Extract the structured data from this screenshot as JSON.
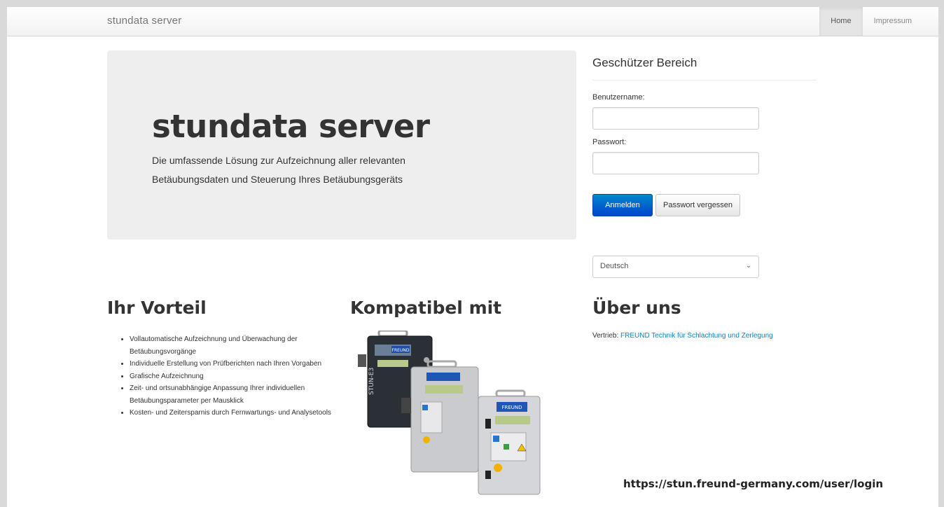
{
  "navbar": {
    "brand": "stundata server",
    "items": [
      {
        "label": "Home",
        "active": true
      },
      {
        "label": "Impressum",
        "active": false
      }
    ]
  },
  "hero": {
    "title": "stundata server",
    "tagline_line1": "Die umfassende Lösung zur Aufzeichnung aller relevanten",
    "tagline_line2": "Betäubungsdaten und Steuerung Ihres Betäubungsgeräts"
  },
  "login": {
    "title": "Geschützer Bereich",
    "username_label": "Benutzername:",
    "username_value": "",
    "password_label": "Passwort:",
    "password_value": "",
    "submit_label": "Anmelden",
    "forgot_label": "Passwort vergessen",
    "language_selected": "Deutsch"
  },
  "vorteil": {
    "title": "Ihr Vorteil",
    "items": [
      "Vollautomatische Aufzeichnung und Überwachung der Betäubungsvorgänge",
      "Individuelle Erstellung von Prüfberichten nach Ihren Vorgaben",
      "Grafische Aufzeichnung",
      "Zeit- und ortsunabhängige Anpassung Ihrer individuellen Betäubungsparameter per Mausklick",
      "Kosten- und Zeitersparnis durch Fernwartungs- und Analysetools"
    ]
  },
  "kompatibel": {
    "title": "Kompatibel mit",
    "device1_label": "STUN-E3",
    "device_brand": "FREUND"
  },
  "ueber": {
    "title": "Über uns",
    "vertrieb_prefix": "Vertrieb:",
    "vertrieb_link": "FREUND Technik für Schlachtung und Zerlegung"
  },
  "url_caption": "https://stun.freund-germany.com/user/login",
  "colors": {
    "primary": "#0055cc",
    "link": "#0088cc",
    "hero_bg": "#eeeeee"
  }
}
